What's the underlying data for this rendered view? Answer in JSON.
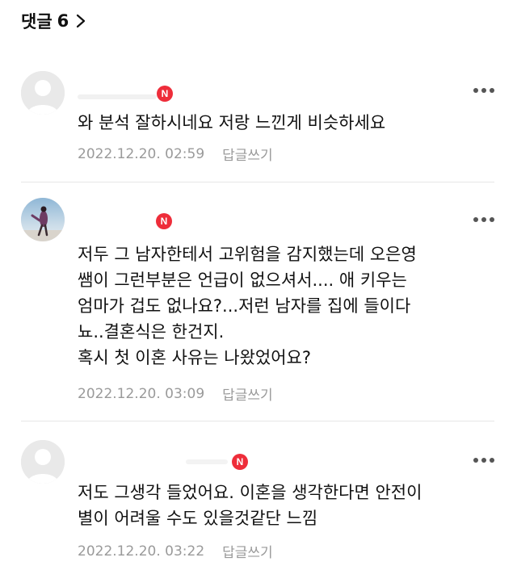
{
  "header": {
    "label": "댓글",
    "count": "6"
  },
  "comments": [
    {
      "badge": "N",
      "text": "와 분석 잘하시네요 저랑 느낀게 비슷하세요",
      "date": "2022.12.20. 02:59",
      "reply_label": "답글쓰기"
    },
    {
      "badge": "N",
      "text": "저두 그 남자한테서 고위험을 감지했는데 오은영\n쌤이 그런부분은 언급이 없으셔서.... 애 키우는\n엄마가 겁도 없나요?...저런 남자를 집에 들이다\n뇨..결혼식은 한건지.\n혹시 첫 이혼 사유는 나왔었어요?",
      "date": "2022.12.20. 03:09",
      "reply_label": "답글쓰기"
    },
    {
      "badge": "N",
      "text": "저도 그생각 들었어요. 이혼을 생각한다면 안전이\n별이 어려울 수도 있을것같단 느낌",
      "date": "2022.12.20. 03:22",
      "reply_label": "답글쓰기"
    }
  ],
  "colors": {
    "badge": "#ee2d3a",
    "meta_text": "#9a9a9a",
    "divider": "#e6e6e6"
  },
  "icons": {
    "header_chevron": "chevron-right-icon",
    "more": "more-horizontal-icon",
    "default_avatar": "default-avatar-icon"
  }
}
